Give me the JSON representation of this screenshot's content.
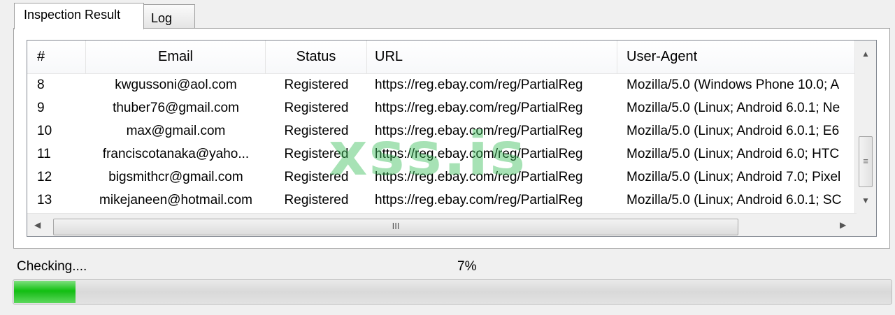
{
  "tabs": [
    {
      "label": "Inspection Result",
      "active": true
    },
    {
      "label": "Log",
      "active": false
    }
  ],
  "table": {
    "columns": [
      "#",
      "Email",
      "Status",
      "URL",
      "User-Agent"
    ],
    "rows": [
      [
        "8",
        "kwgussoni@aol.com",
        "Registered",
        "https://reg.ebay.com/reg/PartialReg",
        "Mozilla/5.0 (Windows Phone 10.0; A"
      ],
      [
        "9",
        "thuber76@gmail.com",
        "Registered",
        "https://reg.ebay.com/reg/PartialReg",
        "Mozilla/5.0 (Linux; Android 6.0.1; Ne"
      ],
      [
        "10",
        "max@gmail.com",
        "Registered",
        "https://reg.ebay.com/reg/PartialReg",
        "Mozilla/5.0 (Linux; Android 6.0.1; E6"
      ],
      [
        "11",
        "franciscotanaka@yaho...",
        "Registered",
        "https://reg.ebay.com/reg/PartialReg",
        "Mozilla/5.0 (Linux; Android 6.0; HTC"
      ],
      [
        "12",
        "bigsmithcr@gmail.com",
        "Registered",
        "https://reg.ebay.com/reg/PartialReg",
        "Mozilla/5.0 (Linux; Android 7.0; Pixel"
      ],
      [
        "13",
        "mikejaneen@hotmail.com",
        "Registered",
        "https://reg.ebay.com/reg/PartialReg",
        "Mozilla/5.0 (Linux; Android 6.0.1; SC"
      ]
    ]
  },
  "watermark": "xss.is",
  "status_text": "Checking....",
  "progress": {
    "label": "7%",
    "value": 0.07,
    "color": "#11c011"
  },
  "icons": {
    "scroll_up": "▲",
    "scroll_down": "▼",
    "scroll_left": "◀",
    "scroll_right": "▶",
    "vgrip": "≡",
    "hgrip": "III"
  }
}
